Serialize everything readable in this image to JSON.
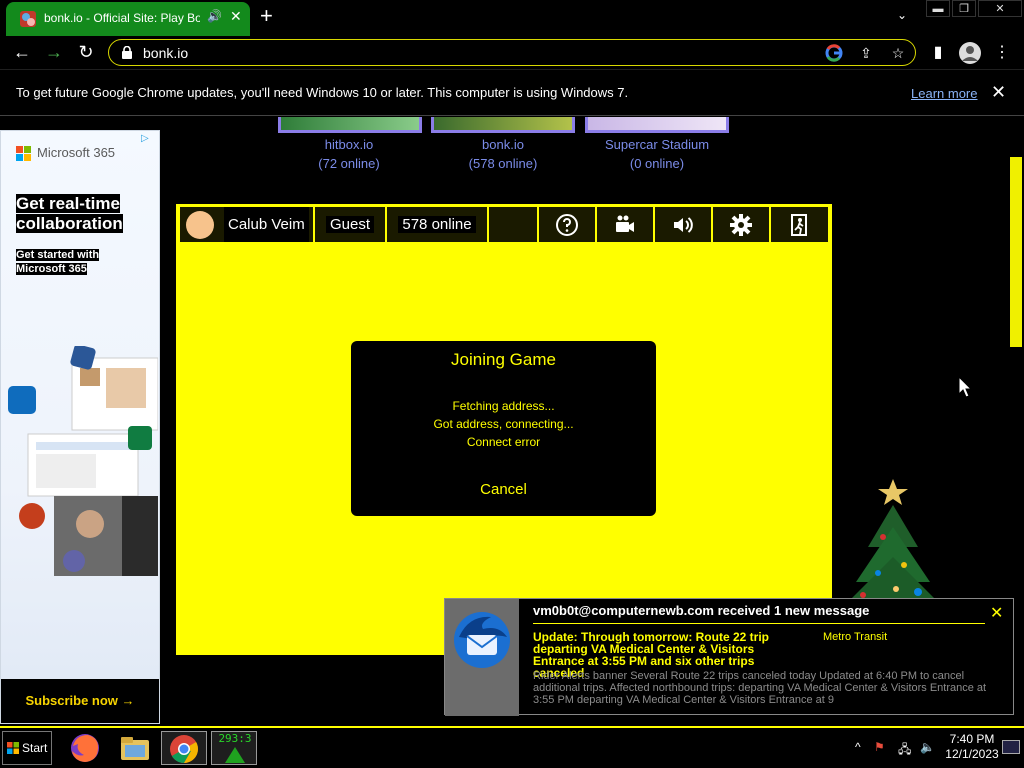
{
  "tab": {
    "title": "bonk.io - Official Site: Play Bonk",
    "audio_icon": "speaker-icon",
    "close": "✕"
  },
  "new_tab": "+",
  "window": {
    "minimize": "▬",
    "restore": "❐",
    "close": "✕"
  },
  "toolbar": {
    "url": "bonk.io"
  },
  "infobar": {
    "message": "To get future Google Chrome updates, you'll need Windows 10 or later. This computer is using Windows 7.",
    "link": "Learn more",
    "close": "✕"
  },
  "ad": {
    "brand": "Microsoft 365",
    "headline_1": "Get real-time",
    "headline_2": "collaboration",
    "sub_1": "Get started with",
    "sub_2": "Microsoft 365",
    "cta": "Subscribe now →",
    "adchoices": "▷"
  },
  "games": [
    {
      "name": "hitbox.io",
      "online": "(72 online)"
    },
    {
      "name": "bonk.io",
      "online": "(578 online)"
    },
    {
      "name": "Supercar Stadium",
      "online": "(0 online)"
    }
  ],
  "gamebar": {
    "player_name": "Calub Veim",
    "account": "Guest",
    "online": "578 online",
    "icons": [
      "help-icon",
      "camera-icon",
      "volume-icon",
      "settings-icon",
      "exit-icon"
    ]
  },
  "dialog": {
    "title": "Joining Game",
    "lines": [
      "Fetching address...",
      "Got address, connecting...",
      "Connect error"
    ],
    "cancel": "Cancel"
  },
  "notification": {
    "heading": "vm0b0t@computernewb.com received 1 new message",
    "subject": "Update: Through tomorrow: Route 22 trip departing VA Medical Center & Visitors Entrance at 3:55 PM and six other trips canceled",
    "sender": "Metro Transit",
    "body": "Rider Alerts banner Several Route 22 trips canceled today Updated at 6:40 PM to cancel additional trips. Affected northbound trips: departing VA Medical Center & Visitors Entrance at 3:55 PM departing VA Medical Center & Visitors Entrance at 9",
    "close": "✕"
  },
  "taskbar": {
    "start": "Start",
    "app_counter": "293:3",
    "clock_time": "7:40 PM",
    "clock_date": "12/1/2023",
    "tray_chevron": "^"
  },
  "colors": {
    "accent": "#ffff00",
    "tab_green": "#138a1c",
    "link_purple": "#7b8ce8"
  }
}
